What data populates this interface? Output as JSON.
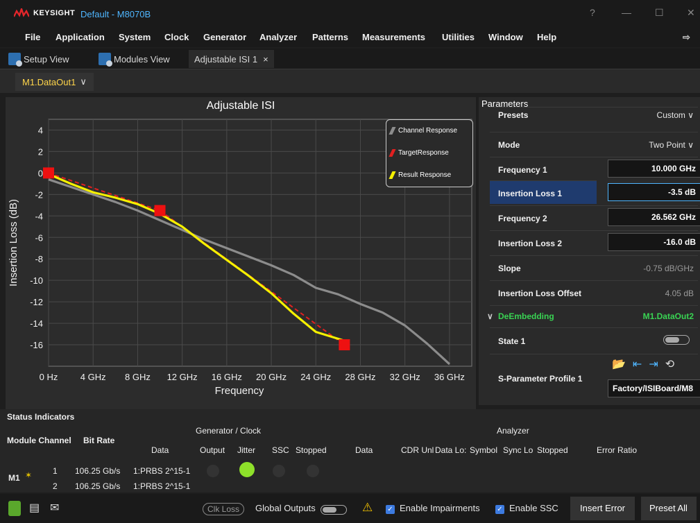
{
  "app": {
    "brand": "KEYSIGHT",
    "title": "Default - M8070B",
    "win_help": "?",
    "win_min": "—",
    "win_max": "☐",
    "win_close": "✕"
  },
  "menu": [
    "File",
    "Application",
    "System",
    "Clock",
    "Generator",
    "Analyzer",
    "Patterns",
    "Measurements",
    "Utilities",
    "Window",
    "Help"
  ],
  "tabs": [
    {
      "label": "Setup View"
    },
    {
      "label": "Modules View"
    },
    {
      "label": "Adjustable ISI 1"
    }
  ],
  "tab_close": "×",
  "channel": {
    "value": "M1.DataOut1",
    "chevron": "∨"
  },
  "chart_data": {
    "type": "line",
    "title": "Adjustable ISI",
    "xlabel": "Frequency",
    "ylabel": "Insertion Loss (dB)",
    "xlim": [
      0,
      38
    ],
    "ylim": [
      -18,
      5
    ],
    "x_ticks": [
      {
        "v": 0,
        "label": "0 Hz"
      },
      {
        "v": 4,
        "label": "4 GHz"
      },
      {
        "v": 8,
        "label": "8 GHz"
      },
      {
        "v": 12,
        "label": "12 GHz"
      },
      {
        "v": 16,
        "label": "16 GHz"
      },
      {
        "v": 20,
        "label": "20 GHz"
      },
      {
        "v": 24,
        "label": "24 GHz"
      },
      {
        "v": 28,
        "label": "28 GHz"
      },
      {
        "v": 32,
        "label": "32 GHz"
      },
      {
        "v": 36,
        "label": "36 GHz"
      }
    ],
    "y_ticks": [
      {
        "v": 4,
        "label": "4"
      },
      {
        "v": 2,
        "label": "2"
      },
      {
        "v": 0,
        "label": "0"
      },
      {
        "v": -2,
        "label": "-2"
      },
      {
        "v": -4,
        "label": "-4"
      },
      {
        "v": -6,
        "label": "-6"
      },
      {
        "v": -8,
        "label": "-8"
      },
      {
        "v": -10,
        "label": "-10"
      },
      {
        "v": -12,
        "label": "-12"
      },
      {
        "v": -14,
        "label": "-14"
      },
      {
        "v": -16,
        "label": "-16"
      }
    ],
    "series": [
      {
        "name": "Channel Response",
        "color": "#8c8c8c",
        "x": [
          0,
          2,
          4,
          6,
          8,
          10,
          12,
          14,
          16,
          18,
          20,
          22,
          24,
          26,
          28,
          30,
          32,
          34,
          36
        ],
        "y": [
          -0.6,
          -1.3,
          -2.0,
          -2.7,
          -3.5,
          -4.4,
          -5.3,
          -6.2,
          -7.0,
          -7.8,
          -8.6,
          -9.5,
          -10.7,
          -11.3,
          -12.2,
          -13.0,
          -14.2,
          -15.9,
          -17.8
        ]
      },
      {
        "name": "TargetResponse",
        "color": "#e02020",
        "dashed": true,
        "x": [
          0,
          10,
          26.562
        ],
        "y": [
          0,
          -3.5,
          -16.0
        ]
      },
      {
        "name": "Result Response",
        "color": "#f5f000",
        "x": [
          0,
          2,
          4,
          6,
          8,
          10,
          12,
          14,
          16,
          18,
          20,
          22,
          24,
          26.5
        ],
        "y": [
          -0.1,
          -1.0,
          -1.8,
          -2.3,
          -2.9,
          -3.8,
          -5.0,
          -6.6,
          -8.1,
          -9.6,
          -11.2,
          -13.1,
          -14.8,
          -15.6
        ]
      }
    ],
    "markers": [
      {
        "x": 0,
        "y": 0
      },
      {
        "x": 10,
        "y": -3.5
      },
      {
        "x": 26.562,
        "y": -16.0
      }
    ]
  },
  "params": {
    "header": "Parameters",
    "rows": [
      {
        "label": "Presets",
        "value": "Custom ∨"
      },
      {
        "label": "Mode",
        "value": "Two Point ∨"
      },
      {
        "label": "Frequency 1",
        "value": "10.000 GHz",
        "box": true
      },
      {
        "label": "Insertion Loss 1",
        "value": "-3.5 dB",
        "box": true,
        "selected": true
      },
      {
        "label": "Frequency 2",
        "value": "26.562 GHz",
        "box": true
      },
      {
        "label": "Insertion Loss 2",
        "value": "-16.0 dB",
        "box": true
      },
      {
        "label": "Slope",
        "value": "-0.75 dB/GHz"
      },
      {
        "label": "Insertion Loss Offset",
        "value": "4.05 dB"
      }
    ],
    "deemb_label": "DeEmbedding",
    "deemb_value": "M1.DataOut2",
    "state_label": "State 1",
    "sparam_label": "S-Parameter Profile 1",
    "sparam_value": "Factory/ISIBoard/M8"
  },
  "status": {
    "header": "Status Indicators",
    "gen_header": "Generator / Clock",
    "ana_header": "Analyzer",
    "col_module_channel": "Module Channel",
    "col_bitrate": "Bit Rate",
    "gen_cols": [
      "Data",
      "Output",
      "Jitter",
      "SSC",
      "Stopped"
    ],
    "ana_cols": [
      "Data",
      "CDR Unl",
      "Data Lo:",
      "Symbol",
      "Sync Lo",
      "Stopped",
      "Error Ratio"
    ],
    "module": "M1",
    "rows": [
      {
        "ch": "1",
        "rate": "106.25 Gb/s",
        "data": "1:PRBS 2^15-1"
      },
      {
        "ch": "2",
        "rate": "106.25 Gb/s",
        "data": "1:PRBS 2^15-1"
      }
    ]
  },
  "footer": {
    "clk_loss": "Clk Loss",
    "global_outputs": "Global Outputs",
    "enable_impairments": "Enable Impairments",
    "enable_ssc": "Enable SSC",
    "insert_error": "Insert Error",
    "preset_all": "Preset All"
  }
}
